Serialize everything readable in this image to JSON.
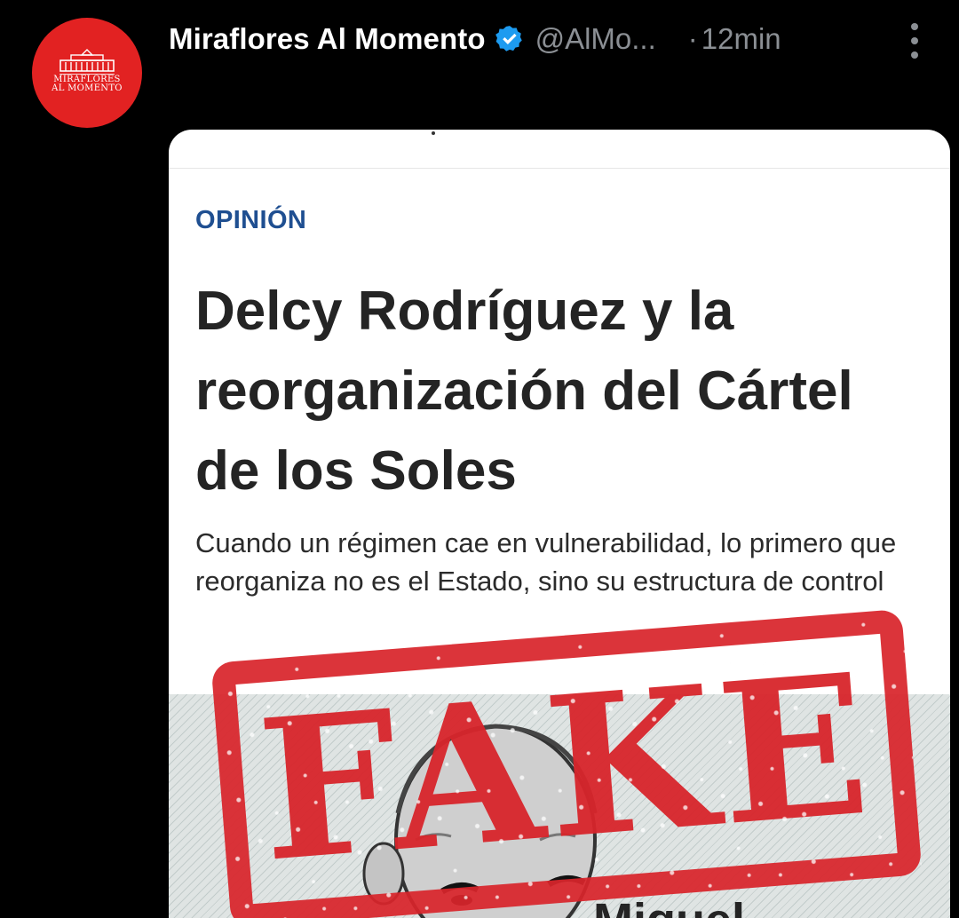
{
  "post": {
    "author_name": "Miraflores Al Momento",
    "handle": "@AlMo...",
    "separator": "·",
    "time": "12min",
    "avatar": {
      "brand_line_1": "MIRAFLORES",
      "brand_line_2": "AL MOMENTO",
      "background": "#e22222"
    },
    "verified_color": "#1d9bf0",
    "icons": [
      "verified-badge-icon",
      "more-options-icon"
    ]
  },
  "article": {
    "kicker": "OPINIÓN",
    "headline": "Delcy Rodríguez y la reorganización del Cártel de los Soles",
    "subhead": "Cuando un régimen cae en vulnerabilidad, lo primero que reorganiza no es el Estado, sino su estructura de control",
    "byline_fragment": "Miguel",
    "kicker_color": "#1f4f91"
  },
  "stamp": {
    "text": "FAKE",
    "color": "#d8252b"
  }
}
